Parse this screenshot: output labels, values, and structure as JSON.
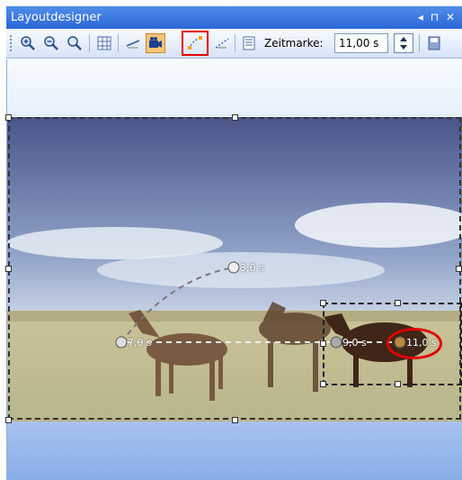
{
  "window": {
    "title": "Layoutdesigner",
    "pin_glyphs": "◂ ⊓ ✕"
  },
  "toolbar": {
    "zoom_in": "zoom-in-icon",
    "zoom_out": "zoom-out-icon",
    "zoom_fit": "zoom-fit-icon",
    "grid": "grid-icon",
    "motion": "motion-path-icon",
    "camera": "camera-icon",
    "keyframe_path": "keyframe-path-icon",
    "keyframe_path2": "keyframe-path-alt-icon",
    "properties": "properties-icon",
    "zeitmarke_label": "Zeitmarke:",
    "zeitmarke_value": "11,00 s",
    "save": "save-icon"
  },
  "keyframes": [
    {
      "label": "7,0 s"
    },
    {
      "label": "3,0 s"
    },
    {
      "label": "9,0 s"
    },
    {
      "label": "11,0 s"
    }
  ],
  "colors": {
    "titlebar": "#2b67d8",
    "highlight_red": "#e30000",
    "toolbar_bg": "#d7e3f7"
  }
}
